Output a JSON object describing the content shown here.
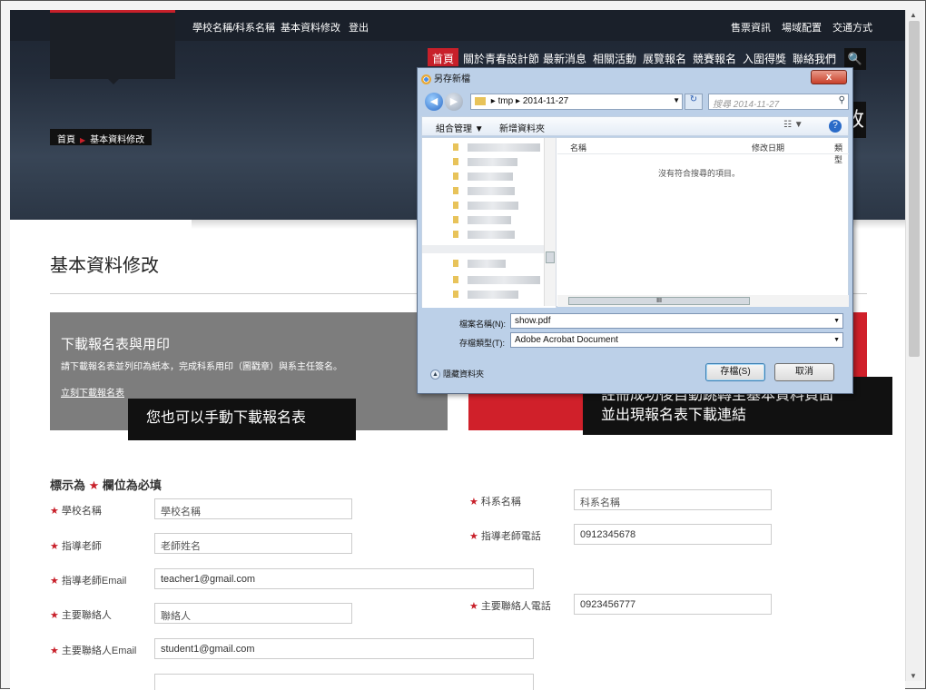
{
  "header": {
    "top_links": [
      "學校名稱/科系名稱",
      "基本資料修改",
      "登出"
    ],
    "right_links": [
      "售票資訊",
      "場域配置",
      "交通方式"
    ],
    "nav": [
      "首頁",
      "關於青春設計節",
      "最新消息",
      "相關活動",
      "展覽報名",
      "競賽報名",
      "入圍得獎",
      "聯絡我們"
    ],
    "breadcrumb": {
      "home": "首頁",
      "current": "基本資料修改"
    },
    "page_title_fragment": "改"
  },
  "main": {
    "title": "基本資料修改",
    "download_box": {
      "title": "下載報名表與用印",
      "desc": "請下載報名表並列印為紙本，完成科系用印（圖戳章）與系主任簽名。",
      "link": "立刻下載報名表"
    }
  },
  "callouts": {
    "manual": "您也可以手動下載報名表",
    "auto_line1": "註冊成功後自動跳轉至基本資料頁面",
    "auto_line2": "並出現報名表下載連結"
  },
  "form": {
    "required_note_pre": "標示為",
    "star": "★",
    "required_note_post": "欄位為必填",
    "fields": [
      {
        "label": "學校名稱",
        "value": "學校名稱"
      },
      {
        "label": "科系名稱",
        "value": "科系名稱"
      },
      {
        "label": "指導老師",
        "value": "老師姓名"
      },
      {
        "label": "指導老師電話",
        "value": "0912345678"
      },
      {
        "label": "指導老師Email",
        "value": "teacher1@gmail.com"
      },
      {
        "label": "主要聯絡人",
        "value": "聯絡人"
      },
      {
        "label": "主要聯絡人電話",
        "value": "0923456777"
      },
      {
        "label": "主要聯絡人Email",
        "value": "student1@gmail.com"
      }
    ]
  },
  "dialog": {
    "title": "另存新檔",
    "close": "x",
    "path": [
      "tmp",
      "2014-11-27"
    ],
    "search_placeholder": "搜尋 2014-11-27",
    "toolbar": {
      "organize": "組合管理 ▼",
      "new_folder": "新增資料夾",
      "view": "☷ ▼",
      "help": "?"
    },
    "columns": [
      "名稱",
      "修改日期",
      "類型"
    ],
    "empty_msg": "沒有符合搜尋的項目。",
    "filename_label": "檔案名稱(N):",
    "filename": "show.pdf",
    "filetype_label": "存檔類型(T):",
    "filetype": "Adobe Acrobat Document",
    "hide_folders": "隱藏資料夾",
    "save": "存檔(S)",
    "cancel": "取消"
  }
}
